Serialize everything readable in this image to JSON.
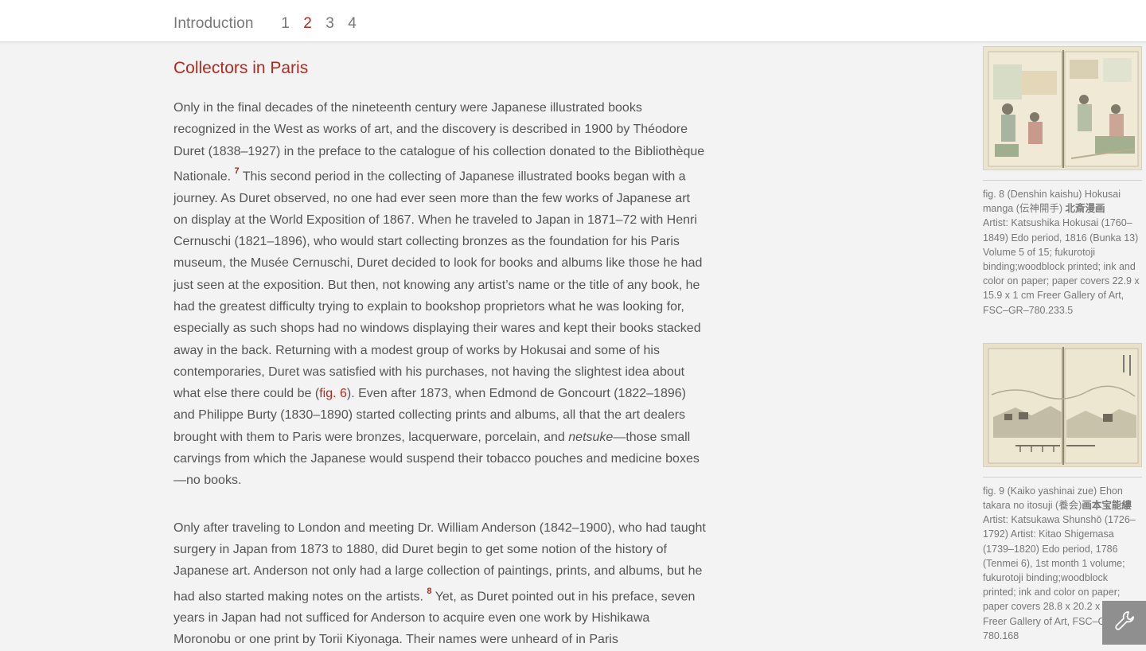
{
  "nav": {
    "intro_label": "Introduction",
    "pages": [
      "1",
      "2",
      "3",
      "4"
    ],
    "active_page": "2"
  },
  "section": {
    "title": "Collectors in Paris"
  },
  "paragraph1": {
    "part1": "Only in the final decades of the nineteenth century were Japanese illustrated books recognized in the West as works of art, and the discovery is described in 1900 by Théodore Duret (1838–1927) in the preface to the catalogue of his collection donated to the Bibliothèque Nationale.",
    "footnote": "7",
    "part2": " This second period in the collecting of Japanese illustrated books began with a journey. As Duret observed, no one had ever seen more than the few works of Japanese art on display at the World Exposition of 1867. When he traveled to Japan in 1871–72 with Henri Cernuschi (1821–1896), who would start collecting bronzes as the foundation for his Paris museum, the Musée Cernuschi, Duret decided to look for books and albums like those he had just seen at the exposition. But then, not knowing any artist’s name or the title of any book, he had the greatest difficulty trying to explain to bookshop proprietors what he was looking for, especially as such shops had no windows displaying their wares and kept their books stacked away in the back. Returning with a modest group of works by Hokusai and some of his contemporaries, Duret was satisfied with his purchases, not having the slightest idea about what else there could be (",
    "fig_link": "fig. 6",
    "part3": "). Even after 1873, when Edmond de Goncourt (1822–1896) and Philippe Burty (1830–1890) started collecting prints and albums, all that the art dealers brought with them to Paris were bronzes, lacquerware, porcelain, and ",
    "italic": "netsuke",
    "part4": "—those small carvings from which the Japanese would suspend their tobacco pouches and medicine boxes—no books."
  },
  "paragraph2": {
    "part1": "Only after traveling to London and meeting Dr. William Anderson (1842–1900), who had taught surgery in Japan from 1873 to 1880, did Duret begin to get some notion of the history of Japanese art. Anderson not only had a large collection of paintings, prints, and albums, but he had also started making notes on the artists.",
    "footnote": "8",
    "part2": " Yet, as Duret pointed out in his preface, seven years in Japan had not sufficed for Anderson to acquire even one work by Hishikawa Moronobu or one print by Torii Kiyonaga. Their names were unheard of in Paris"
  },
  "figures": [
    {
      "caption_a": "fig. 8 (Denshin kaishu) Hokusai manga (伝神開手)",
      "caption_cjk": "北斎漫画",
      "caption_b": "Artist: Katsushika Hokusai (1760–1849) Edo period, 1816 (Bunka 13) Volume 5 of 15; fukurotoji binding;woodblock printed; ink and color on paper; paper covers 22.9 x 15.9 x 1 cm Freer Gallery of Art, FSC–GR–780.233.5"
    },
    {
      "caption_a": "fig. 9 (Kaiko yashinai zue) Ehon takara no itosuji (養会)",
      "caption_cjk": "画本宝能縷",
      "caption_b": "Artist: Katsukawa Shunshō (1726–1792) Artist: Kitao Shigemasa (1739–1820) Edo period, 1786 (Tenmei 6), 1st month 1 volume; fukurotoji binding;woodblock printed; ink and color on paper; paper covers 28.8 x 20.2 x 0.7 cm Freer Gallery of Art, FSC–GR–780.168"
    }
  ],
  "tools": {
    "icon": "wrench-icon"
  }
}
